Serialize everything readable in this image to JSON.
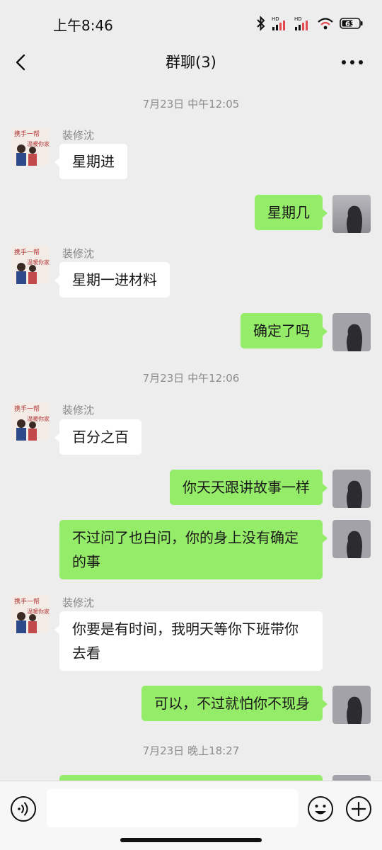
{
  "status_bar": {
    "time": "上午8:46",
    "signal1_label": "HD",
    "signal2_label": "HD",
    "battery": "63"
  },
  "nav": {
    "title": "群聊(3)"
  },
  "messages": [
    {
      "type": "time",
      "text": "7月23日 中午12:05"
    },
    {
      "type": "in",
      "sender": "装修沈",
      "text": "星期进"
    },
    {
      "type": "out",
      "text": "星期几"
    },
    {
      "type": "in",
      "sender": "装修沈",
      "text": "星期一进材料"
    },
    {
      "type": "out",
      "text": "确定了吗"
    },
    {
      "type": "time",
      "text": "7月23日 中午12:06"
    },
    {
      "type": "in",
      "sender": "装修沈",
      "text": "百分之百"
    },
    {
      "type": "out",
      "text": "你天天跟讲故事一样"
    },
    {
      "type": "out",
      "text": "不过问了也白问，你的身上没有确定的事"
    },
    {
      "type": "in",
      "sender": "装修沈",
      "text": "你要是有时间，我明天等你下班带你去看"
    },
    {
      "type": "out",
      "text": "可以，不过就怕你不现身"
    },
    {
      "type": "time",
      "text": "7月23日 晚上18:27"
    }
  ],
  "avatar_in": {
    "line1": "携手一帮",
    "line2": "温暖你家"
  },
  "input": {
    "placeholder": ""
  },
  "colors": {
    "out_bubble": "#95ec69",
    "in_bubble": "#ffffff",
    "background": "#ededed"
  }
}
